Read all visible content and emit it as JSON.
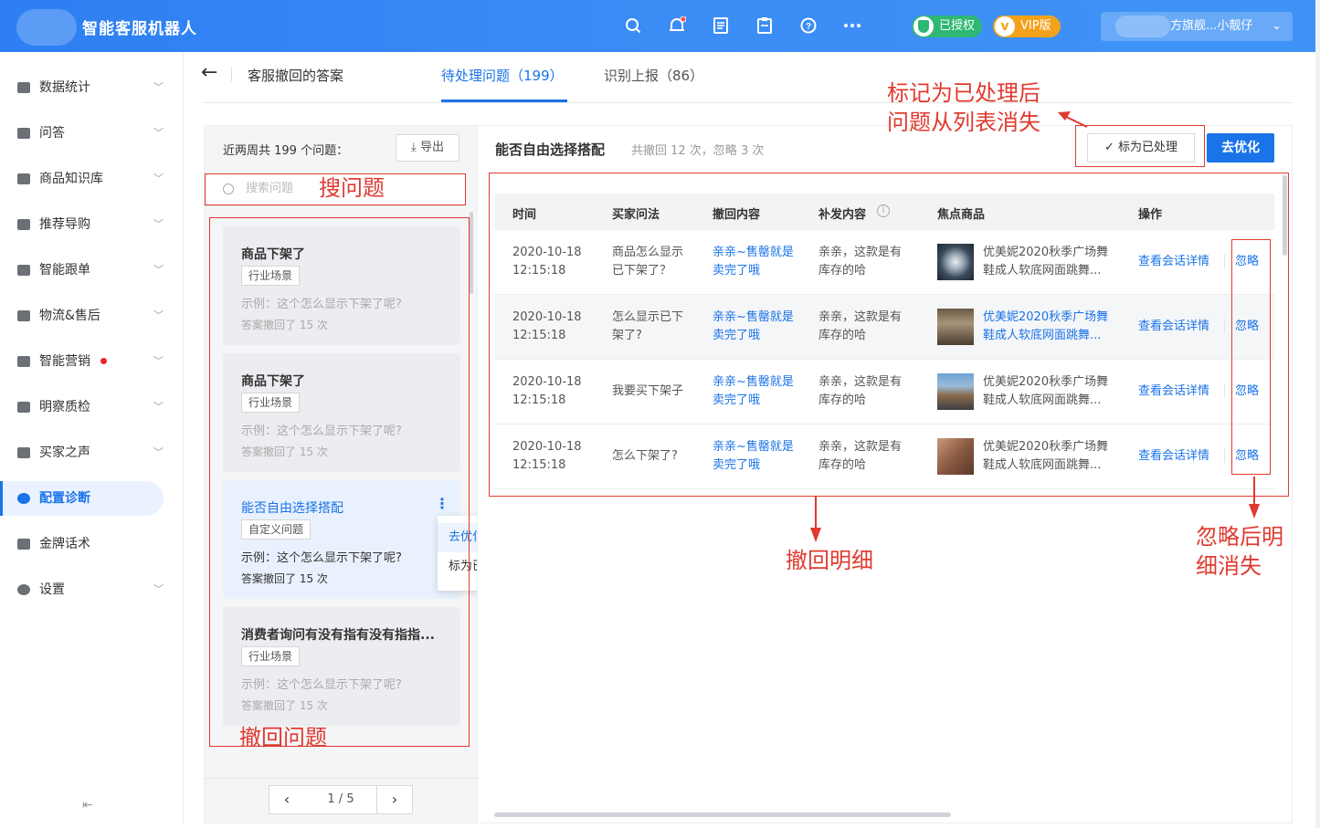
{
  "header": {
    "app_title": "智能客服机器人",
    "auth_badge": "已授权",
    "vip_badge": "VIP版",
    "user_name": "方旗舰...小靓仔",
    "icons": [
      "search-icon",
      "bell-icon",
      "document-icon",
      "clipboard-icon",
      "help-icon",
      "more-icon"
    ]
  },
  "sidebar": {
    "items": [
      {
        "label": "数据统计",
        "icon": "chart-icon"
      },
      {
        "label": "问答",
        "icon": "chat-icon"
      },
      {
        "label": "商品知识库",
        "icon": "book-icon"
      },
      {
        "label": "推荐导购",
        "icon": "cart-icon"
      },
      {
        "label": "智能跟单",
        "icon": "layers-icon"
      },
      {
        "label": "物流&售后",
        "icon": "truck-icon"
      },
      {
        "label": "智能营销",
        "icon": "marketing-icon"
      },
      {
        "label": "明察质检",
        "icon": "inspect-icon"
      },
      {
        "label": "买家之声",
        "icon": "user-voice-icon"
      },
      {
        "label": "配置诊断",
        "icon": "diagnose-icon"
      },
      {
        "label": "金牌话术",
        "icon": "medal-icon"
      },
      {
        "label": "设置",
        "icon": "gear-icon"
      }
    ],
    "active_index": 9
  },
  "page": {
    "title": "客服撤回的答案",
    "tabs": [
      {
        "label": "待处理问题（199）"
      },
      {
        "label": "识别上报（86）"
      }
    ]
  },
  "list_panel": {
    "summary": "近两周共 199 个问题：",
    "export_label": "导出",
    "search_placeholder": "搜索问题",
    "questions": [
      {
        "title": "商品下架了",
        "tag": "行业场景",
        "example": "示例：这个怎么显示下架了呢?",
        "count": "答案撤回了 15 次"
      },
      {
        "title": "商品下架了",
        "tag": "行业场景",
        "example": "示例：这个怎么显示下架了呢?",
        "count": "答案撤回了 15 次"
      },
      {
        "title": "能否自由选择搭配",
        "tag": "自定义问题",
        "example": "示例：这个怎么显示下架了呢?",
        "count": "答案撤回了 15 次"
      },
      {
        "title": "消费者询问有没有指有没有指指...",
        "tag": "行业场景",
        "example": "示例：这个怎么显示下架了呢?",
        "count": "答案撤回了 15 次"
      }
    ],
    "popup_menu": [
      "去优化",
      "标为已处理"
    ],
    "pager": {
      "text": "1 / 5"
    }
  },
  "detail": {
    "title": "能否自由选择搭配",
    "subtitle": "共撤回 12 次，忽略 3 次",
    "mark_done_label": "标为已处理",
    "optimize_label": "去优化",
    "columns": [
      "时间",
      "买家问法",
      "撤回内容",
      "补发内容",
      "焦点商品",
      "操作"
    ],
    "rows": [
      {
        "date": "2020-10-18",
        "time": "12:15:18",
        "q1": "商品怎么显示",
        "q2": "已下架了？",
        "r1": "亲亲~售罄就是",
        "r2": "卖完了哦",
        "s1": "亲亲，这款是有",
        "s2": "库存的哈",
        "p1": "优美妮2020秋季广场舞",
        "p2": "鞋成人软底网面跳舞...",
        "view": "查看会话详情",
        "ignore": "忽略"
      },
      {
        "date": "2020-10-18",
        "time": "12:15:18",
        "q1": "怎么显示已下",
        "q2": "架了?",
        "r1": "亲亲~售罄就是",
        "r2": "卖完了哦",
        "s1": "亲亲，这款是有",
        "s2": "库存的哈",
        "p1": "优美妮2020秋季广场舞",
        "p2": "鞋成人软底网面跳舞...",
        "view": "查看会话详情",
        "ignore": "忽略"
      },
      {
        "date": "2020-10-18",
        "time": "12:15:18",
        "q1": "我要买下架子",
        "q2": "",
        "r1": "亲亲~售罄就是",
        "r2": "卖完了哦",
        "s1": "亲亲，这款是有",
        "s2": "库存的哈",
        "p1": "优美妮2020秋季广场舞",
        "p2": "鞋成人软底网面跳舞...",
        "view": "查看会话详情",
        "ignore": "忽略"
      },
      {
        "date": "2020-10-18",
        "time": "12:15:18",
        "q1": "怎么下架了?",
        "q2": "",
        "r1": "亲亲~售罄就是",
        "r2": "卖完了哦",
        "s1": "亲亲，这款是有",
        "s2": "库存的哈",
        "p1": "优美妮2020秋季广场舞",
        "p2": "鞋成人软底网面跳舞...",
        "view": "查看会话详情",
        "ignore": "忽略"
      }
    ]
  },
  "annotations": {
    "search": "搜问题",
    "list": "撤回问题",
    "mark_line1": "标记为已处理后",
    "mark_line2": "问题从列表消失",
    "detail": "撤回明细",
    "ignore_line1": "忽略后明",
    "ignore_line2": "细消失"
  },
  "colors": {
    "primary": "#1a73e8",
    "annotation": "#e03a2f",
    "auth": "#2eb873",
    "vip": "#f4a21b"
  }
}
